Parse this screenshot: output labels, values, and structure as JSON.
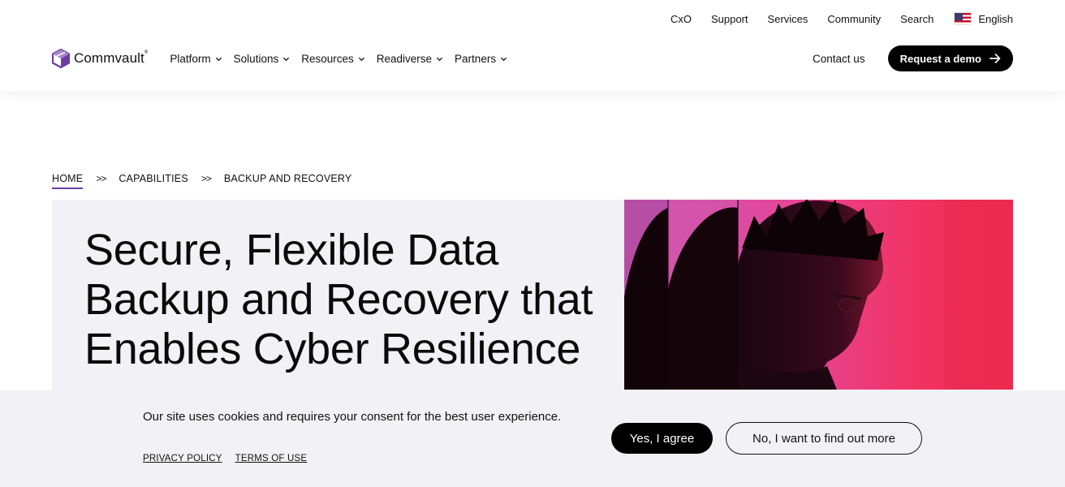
{
  "utility_nav": {
    "items": [
      "CxO",
      "Support",
      "Services",
      "Community",
      "Search"
    ],
    "language": "English",
    "flag_icon": "us-flag-icon"
  },
  "brand": {
    "name": "Commvault",
    "mark": "®",
    "color": "#6b3fa0"
  },
  "main_nav": {
    "items": [
      {
        "label": "Platform"
      },
      {
        "label": "Solutions"
      },
      {
        "label": "Resources"
      },
      {
        "label": "Readiverse"
      },
      {
        "label": "Partners"
      }
    ],
    "contact_label": "Contact us",
    "demo_label": "Request a demo"
  },
  "breadcrumb": {
    "items": [
      "HOME",
      "CAPABILITIES",
      "BACKUP AND RECOVERY"
    ],
    "separator": ">>"
  },
  "hero": {
    "title": "Secure, Flexible Data Backup and Recovery that Enables Cyber Resilience",
    "image_colors": [
      "#cc5ab0",
      "#f02850"
    ]
  },
  "cookie_banner": {
    "text": "Our site uses cookies and requires your consent for the best user experience.",
    "privacy_label": "PRIVACY POLICY",
    "terms_label": "TERMS OF USE",
    "agree_label": "Yes, I agree",
    "more_label": "No, I want to find out more"
  }
}
